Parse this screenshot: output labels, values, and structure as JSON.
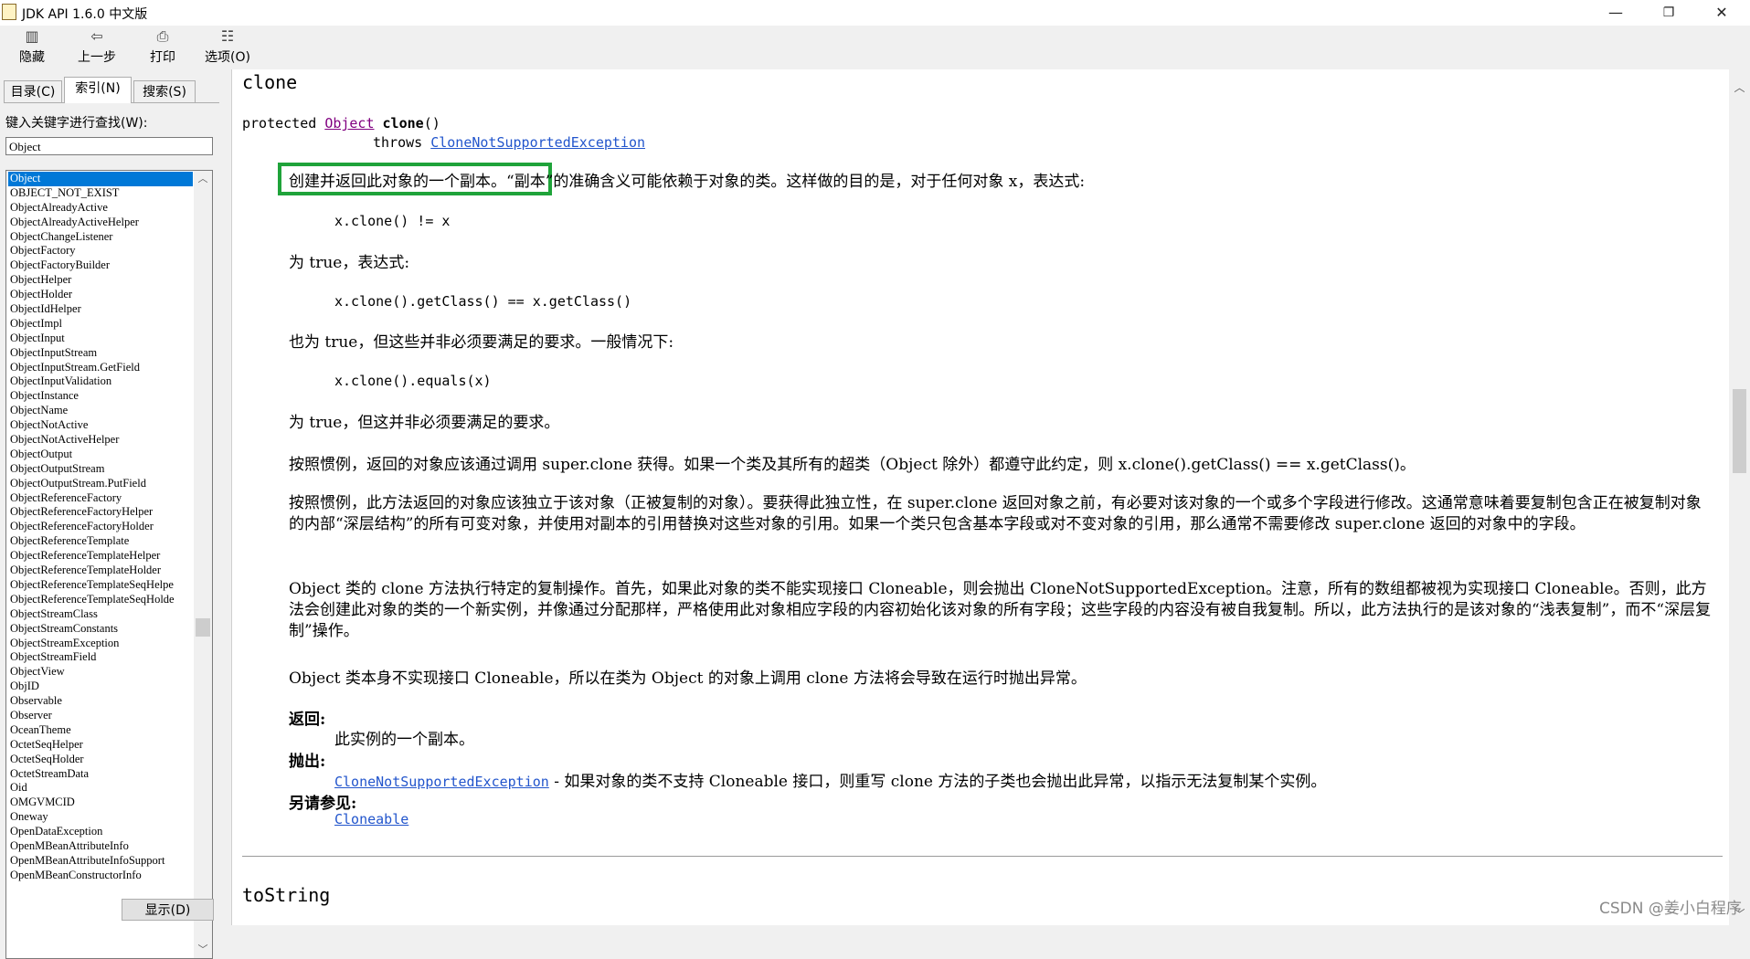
{
  "window": {
    "title": "JDK API 1.6.0 中文版",
    "minimize": "—",
    "maximize": "❐",
    "close": "✕"
  },
  "toolbar": {
    "hide": "隐藏",
    "back": "上一步",
    "print": "打印",
    "options": "选项(O)"
  },
  "tabs": {
    "contents": "目录(C)",
    "index": "索引(N)",
    "search": "搜索(S)"
  },
  "index_panel": {
    "keyword_label": "键入关键字进行查找(W):",
    "keyword_value": "Object",
    "items": [
      "Object",
      "OBJECT_NOT_EXIST",
      "ObjectAlreadyActive",
      "ObjectAlreadyActiveHelper",
      "ObjectChangeListener",
      "ObjectFactory",
      "ObjectFactoryBuilder",
      "ObjectHelper",
      "ObjectHolder",
      "ObjectIdHelper",
      "ObjectImpl",
      "ObjectInput",
      "ObjectInputStream",
      "ObjectInputStream.GetField",
      "ObjectInputValidation",
      "ObjectInstance",
      "ObjectName",
      "ObjectNotActive",
      "ObjectNotActiveHelper",
      "ObjectOutput",
      "ObjectOutputStream",
      "ObjectOutputStream.PutField",
      "ObjectReferenceFactory",
      "ObjectReferenceFactoryHelper",
      "ObjectReferenceFactoryHolder",
      "ObjectReferenceTemplate",
      "ObjectReferenceTemplateHelper",
      "ObjectReferenceTemplateHolder",
      "ObjectReferenceTemplateSeqHelpe",
      "ObjectReferenceTemplateSeqHolde",
      "ObjectStreamClass",
      "ObjectStreamConstants",
      "ObjectStreamException",
      "ObjectStreamField",
      "ObjectView",
      "ObjID",
      "Observable",
      "Observer",
      "OceanTheme",
      "OctetSeqHelper",
      "OctetSeqHolder",
      "OctetStreamData",
      "Oid",
      "OMGVMCID",
      "Oneway",
      "OpenDataException",
      "OpenMBeanAttributeInfo",
      "OpenMBeanAttributeInfoSupport",
      "OpenMBeanConstructorInfo"
    ],
    "display_button": "显示(D)"
  },
  "doc": {
    "method_name": "clone",
    "sig_protected": "protected ",
    "sig_return_type": "Object",
    "sig_method": " clone",
    "sig_parens": "()",
    "sig_throws": "throws ",
    "sig_exception": "CloneNotSupportedException",
    "highlight_text": "创建并返回此对象的一个副本。",
    "intro_rest": "“副本”的准确含义可能依赖于对象的类。这样做的目的是，对于任何对象 x，表达式:",
    "code1": "x.clone() != x",
    "p_true1": "为 true，表达式:",
    "code2": "x.clone().getClass() == x.getClass()",
    "p_true2": "也为 true，但这些并非必须要满足的要求。一般情况下:",
    "code3": "x.clone().equals(x)",
    "p_true3": "为 true，但这并非必须要满足的要求。",
    "p_conv1": "按照惯例，返回的对象应该通过调用 super.clone 获得。如果一个类及其所有的超类（Object 除外）都遵守此约定，则 x.clone().getClass() == x.getClass()。",
    "p_conv2": "按照惯例，此方法返回的对象应该独立于该对象（正被复制的对象）。要获得此独立性，在 super.clone 返回对象之前，有必要对该对象的一个或多个字段进行修改。这通常意味着要复制包含正在被复制对象的内部“深层结构”的所有可变对象，并使用对副本的引用替换对这些对象的引用。如果一个类只包含基本字段或对不变对象的引用，那么通常不需要修改 super.clone 返回的对象中的字段。",
    "p_object": "Object 类的 clone 方法执行特定的复制操作。首先，如果此对象的类不能实现接口 Cloneable，则会抛出 CloneNotSupportedException。注意，所有的数组都被视为实现接口 Cloneable。否则，此方法会创建此对象的类的一个新实例，并像通过分配那样，严格使用此对象相应字段的内容初始化该对象的所有字段；这些字段的内容没有被自我复制。所以，此方法执行的是该对象的“浅表复制”，而不“深层复制”操作。",
    "p_object2": "Object 类本身不实现接口 Cloneable，所以在类为 Object 的对象上调用 clone 方法将会导致在运行时抛出异常。",
    "returns_label": "返回:",
    "returns_text": "此实例的一个副本。",
    "throws_label": "抛出:",
    "throws_link": "CloneNotSupportedException",
    "throws_text": " - 如果对象的类不支持 Cloneable 接口，则重写 clone 方法的子类也会抛出此异常，以指示无法复制某个实例。",
    "see_label": "另请参见:",
    "see_link": "Cloneable",
    "next_method": "toString"
  },
  "watermark": "CSDN @姜小白程序"
}
